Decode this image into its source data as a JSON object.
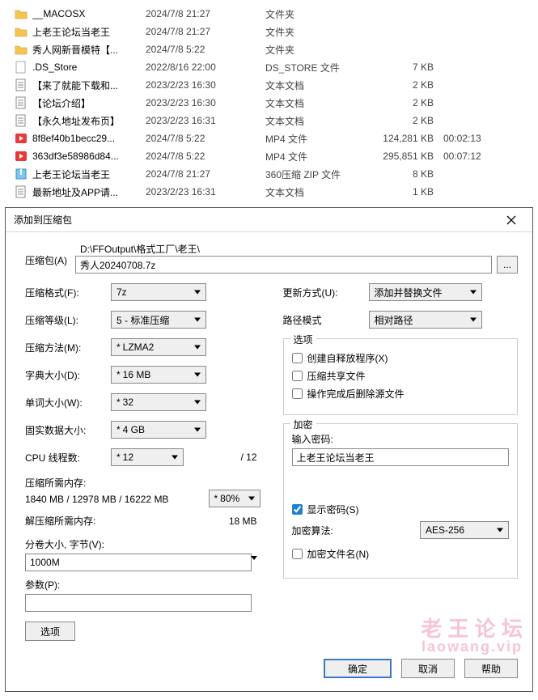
{
  "files": {
    "rows": [
      {
        "name": "__MACOSX",
        "date": "2024/7/8 21:27",
        "type": "文件夹",
        "size": "",
        "dur": "",
        "icon": "folder"
      },
      {
        "name": "上老王论坛当老王",
        "date": "2024/7/8 21:27",
        "type": "文件夹",
        "size": "",
        "dur": "",
        "icon": "folder"
      },
      {
        "name": "秀人网新晋模特【...",
        "date": "2024/7/8 5:22",
        "type": "文件夹",
        "size": "",
        "dur": "",
        "icon": "folder"
      },
      {
        "name": ".DS_Store",
        "date": "2022/8/16 22:00",
        "type": "DS_STORE 文件",
        "size": "7 KB",
        "dur": "",
        "icon": "file"
      },
      {
        "name": "【来了就能下载和...",
        "date": "2023/2/23 16:30",
        "type": "文本文档",
        "size": "2 KB",
        "dur": "",
        "icon": "txt"
      },
      {
        "name": "【论坛介绍】",
        "date": "2023/2/23 16:30",
        "type": "文本文档",
        "size": "2 KB",
        "dur": "",
        "icon": "txt"
      },
      {
        "name": "【永久地址发布页】",
        "date": "2023/2/23 16:31",
        "type": "文本文档",
        "size": "2 KB",
        "dur": "",
        "icon": "txt"
      },
      {
        "name": "8f8ef40b1becc29...",
        "date": "2024/7/8 5:22",
        "type": "MP4 文件",
        "size": "124,281 KB",
        "dur": "00:02:13",
        "icon": "mp4"
      },
      {
        "name": "363df3e58986d84...",
        "date": "2024/7/8 5:22",
        "type": "MP4 文件",
        "size": "295,851 KB",
        "dur": "00:07:12",
        "icon": "mp4"
      },
      {
        "name": "上老王论坛当老王",
        "date": "2024/7/8 21:27",
        "type": "360压缩 ZIP 文件",
        "size": "8 KB",
        "dur": "",
        "icon": "zip"
      },
      {
        "name": "最新地址及APP请...",
        "date": "2023/2/23 16:31",
        "type": "文本文档",
        "size": "1 KB",
        "dur": "",
        "icon": "txt"
      }
    ]
  },
  "dialog": {
    "title": "添加到压缩包",
    "archive_label": "压缩包(A)",
    "archive_path": "D:\\FFOutput\\格式工厂\\老王\\",
    "archive_name": "秀人20240708.7z",
    "browse": "...",
    "left": {
      "format_l": "压缩格式(F):",
      "format_v": "7z",
      "level_l": "压缩等级(L):",
      "level_v": "5 - 标准压缩",
      "method_l": "压缩方法(M):",
      "method_v": "LZMA2",
      "dict_l": "字典大小(D):",
      "dict_v": "16 MB",
      "word_l": "单词大小(W):",
      "word_v": "32",
      "solid_l": "固实数据大小:",
      "solid_v": "4 GB",
      "cpu_l": "CPU 线程数:",
      "cpu_v": "12",
      "cpu_max": "/ 12",
      "mem_need_l": "压缩所需内存:",
      "mem_need_v": "1840 MB / 12978 MB / 16222 MB",
      "mem_pct": "80%",
      "decomp_mem_l": "解压缩所需内存:",
      "decomp_mem_v": "18 MB",
      "split_l": "分卷大小, 字节(V):",
      "split_v": "1000M",
      "params_l": "参数(P):",
      "params_v": "",
      "options_btn": "选项"
    },
    "right": {
      "update_l": "更新方式(U):",
      "update_v": "添加并替换文件",
      "pathmode_l": "路径模式",
      "pathmode_v": "相对路径",
      "options_title": "选项",
      "opt_sfx": "创建自释放程序(X)",
      "opt_share": "压缩共享文件",
      "opt_delete": "操作完成后删除源文件",
      "encrypt_title": "加密",
      "pw_l": "输入密码:",
      "pw_v": "上老王论坛当老王",
      "showpw": "显示密码(S)",
      "algo_l": "加密算法:",
      "algo_v": "AES-256",
      "enc_names": "加密文件名(N)"
    },
    "footer": {
      "ok": "确定",
      "cancel": "取消",
      "help": "帮助"
    }
  },
  "watermark": {
    "l1": "老 王 论 坛",
    "l2": "laowang.vip"
  }
}
